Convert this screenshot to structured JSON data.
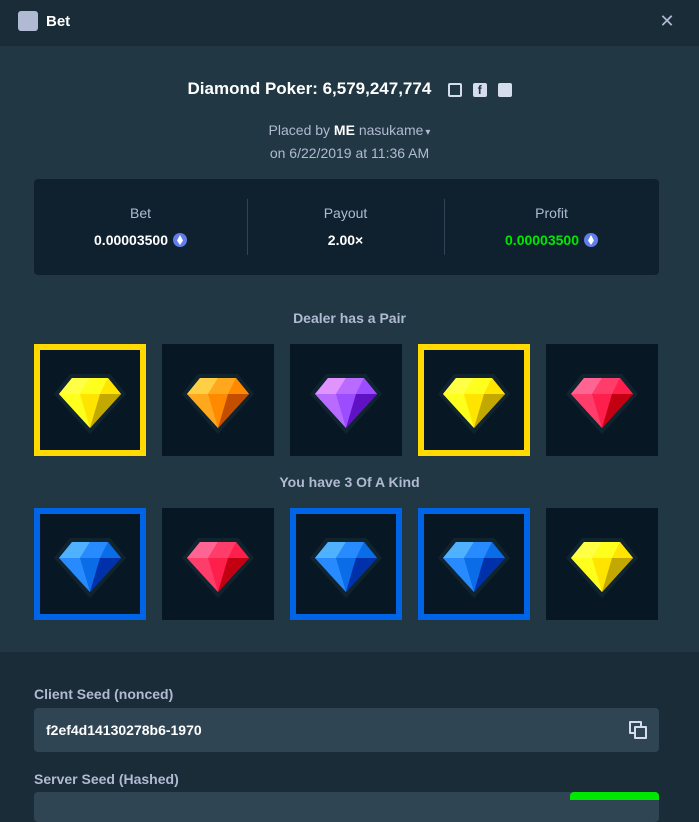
{
  "header": {
    "title": "Bet",
    "icon": "bet-list-icon",
    "close_glyph": "✕"
  },
  "game": {
    "title": "Diamond Poker: 6,579,247,774",
    "placed_prefix": "Placed by",
    "user_prefix": "ME",
    "username": "nasukame",
    "date_line": "on 6/22/2019 at 11:36 AM"
  },
  "stats": {
    "bet_label": "Bet",
    "bet_value": "0.00003500",
    "payout_label": "Payout",
    "payout_value": "2.00×",
    "profit_label": "Profit",
    "profit_value": "0.00003500",
    "currency_icon": "ethereum-icon"
  },
  "dealer": {
    "label": "Dealer has a Pair",
    "cards": [
      {
        "gem": "yellow",
        "highlight": "yellow"
      },
      {
        "gem": "orange",
        "highlight": "none"
      },
      {
        "gem": "purple",
        "highlight": "none"
      },
      {
        "gem": "yellow",
        "highlight": "yellow"
      },
      {
        "gem": "red",
        "highlight": "none"
      }
    ]
  },
  "player": {
    "label": "You have 3 Of A Kind",
    "cards": [
      {
        "gem": "blue",
        "highlight": "blue"
      },
      {
        "gem": "red",
        "highlight": "none"
      },
      {
        "gem": "blue",
        "highlight": "blue"
      },
      {
        "gem": "blue",
        "highlight": "blue"
      },
      {
        "gem": "yellow",
        "highlight": "none"
      }
    ]
  },
  "seeds": {
    "client_label": "Client Seed (nonced)",
    "client_value": "f2ef4d14130278b6-1970",
    "server_label": "Server Seed (Hashed)"
  },
  "colors": {
    "highlight_yellow": "#ffd900",
    "highlight_blue": "#0064e6",
    "profit_green": "#00e701",
    "gem_yellow": "#ffe400",
    "gem_orange": "#ff8a00",
    "gem_purple": "#9b4dff",
    "gem_red": "#ff1f4d",
    "gem_blue": "#0a6ce6"
  }
}
